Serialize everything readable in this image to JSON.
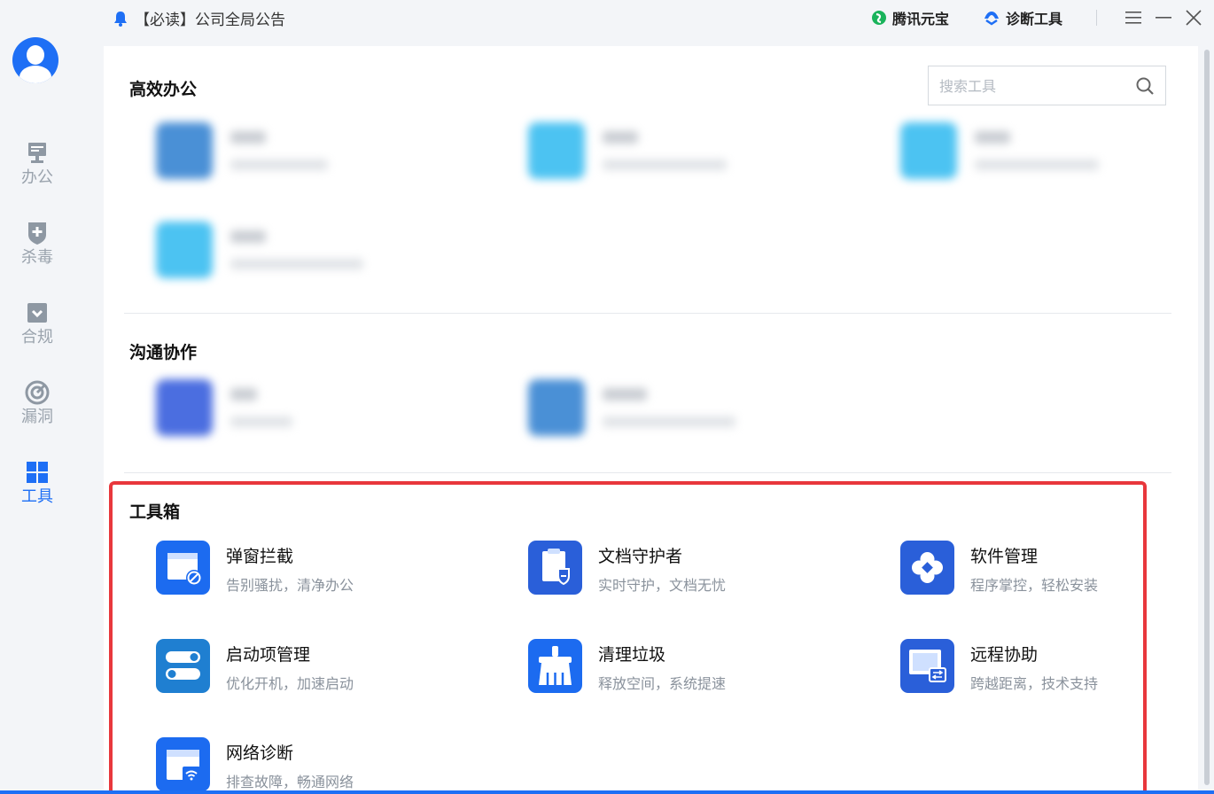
{
  "sidebar": {
    "items": [
      {
        "label": "办公",
        "icon": "monitor-icon"
      },
      {
        "label": "杀毒",
        "icon": "shield-plus-icon"
      },
      {
        "label": "合规",
        "icon": "check-box-icon"
      },
      {
        "label": "漏洞",
        "icon": "radar-icon"
      },
      {
        "label": "工具",
        "icon": "grid-icon",
        "active": true
      }
    ],
    "active_color": "#1e6ff5",
    "inactive_color": "#9aa3ad"
  },
  "topbar": {
    "announcement": "【必读】公司全局公告",
    "links": [
      {
        "label": "腾讯元宝",
        "icon": "yuanbao-icon"
      },
      {
        "label": "诊断工具",
        "icon": "diagnose-icon"
      }
    ]
  },
  "search": {
    "placeholder": "搜索工具",
    "value": ""
  },
  "sections": {
    "office": {
      "title": "高效办公"
    },
    "communication": {
      "title": "沟通协作"
    },
    "toolbox": {
      "title": "工具箱",
      "tools": [
        {
          "name": "弹窗拦截",
          "desc": "告别骚扰，清净办公",
          "icon": "popup-block-icon"
        },
        {
          "name": "文档守护者",
          "desc": "实时守护，文档无忧",
          "icon": "document-guard-icon"
        },
        {
          "name": "软件管理",
          "desc": "程序掌控，轻松安装",
          "icon": "software-manager-icon"
        },
        {
          "name": "启动项管理",
          "desc": "优化开机，加速启动",
          "icon": "startup-toggle-icon"
        },
        {
          "name": "清理垃圾",
          "desc": "释放空间，系统提速",
          "icon": "cleanup-broom-icon"
        },
        {
          "name": "远程协助",
          "desc": "跨越距离，技术支持",
          "icon": "remote-assist-icon"
        },
        {
          "name": "网络诊断",
          "desc": "排查故障，畅通网络",
          "icon": "network-diagnose-icon"
        }
      ]
    }
  },
  "colors": {
    "accent": "#1e6ff5",
    "highlight_border": "#e8373c"
  }
}
